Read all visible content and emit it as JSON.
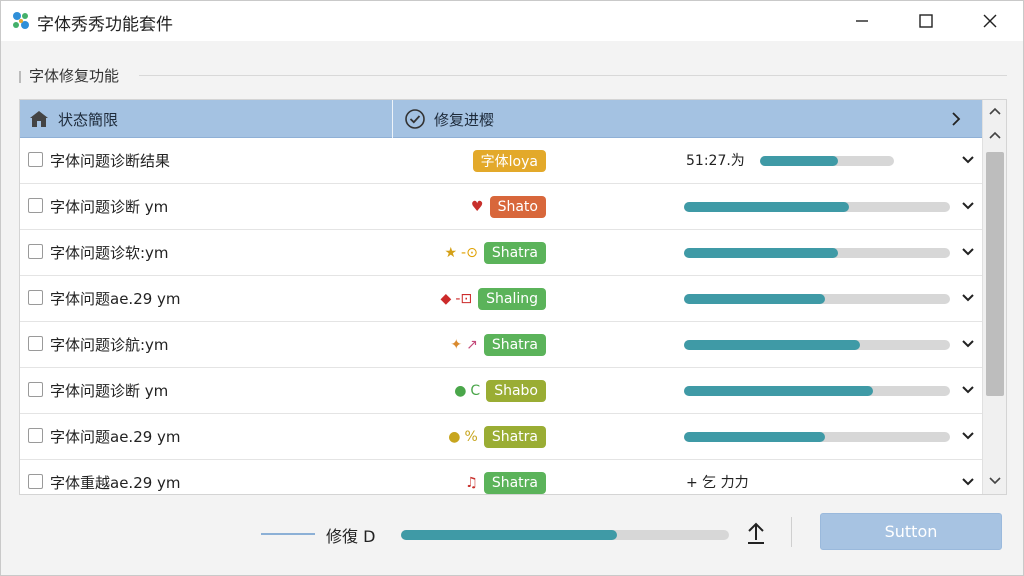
{
  "window": {
    "title": "字体秀秀功能套件",
    "controls": {
      "minimize": "minimize-icon",
      "maximize": "maximize-icon",
      "close": "close-icon"
    }
  },
  "section": {
    "title": "字体修复功能"
  },
  "table": {
    "headers": {
      "status": "状态簡限",
      "repair": "修复进樱"
    },
    "rows": [
      {
        "label": "字体问题诊断结果",
        "badge": "字体loya",
        "badge_color": "#e3a92a",
        "icons": [],
        "progress_text": "51:27.为",
        "progress": 0.58
      },
      {
        "label": "字体问题诊断 ym",
        "badge": "Shato",
        "badge_color": "#d8673b",
        "icons": [
          "♥"
        ],
        "icon_colors": [
          "#c8302c"
        ],
        "progress_text": "",
        "progress": 0.62
      },
      {
        "label": "字体问题诊软:ym",
        "badge": "Shatra",
        "badge_color": "#5bb35a",
        "icons": [
          "★",
          "-⊙"
        ],
        "icon_colors": [
          "#d4a017",
          "#e0a000"
        ],
        "progress_text": "",
        "progress": 0.58
      },
      {
        "label": "字体问题ae.29 ym",
        "badge": "Shaling",
        "badge_color": "#5bb35a",
        "icons": [
          "◆",
          "-⊡"
        ],
        "icon_colors": [
          "#cc2a2a",
          "#cc2a2a"
        ],
        "progress_text": "",
        "progress": 0.53
      },
      {
        "label": "字体问题诊航:ym",
        "badge": "Shatra",
        "badge_color": "#5bb35a",
        "icons": [
          "✦",
          "↗"
        ],
        "icon_colors": [
          "#d98a2e",
          "#c44a7a"
        ],
        "progress_text": "",
        "progress": 0.66
      },
      {
        "label": "字体问题诊断 ym",
        "badge": "Shabo",
        "badge_color": "#9aad34",
        "icons": [
          "●",
          "C"
        ],
        "icon_colors": [
          "#4aa64a",
          "#4aa64a"
        ],
        "progress_text": "",
        "progress": 0.71
      },
      {
        "label": "字体问题ae.29 ym",
        "badge": "Shatra",
        "badge_color": "#9aad34",
        "icons": [
          "●",
          "%"
        ],
        "icon_colors": [
          "#c7a51e",
          "#c7a51e"
        ],
        "progress_text": "",
        "progress": 0.53
      },
      {
        "label": "字体重越ae.29 ym",
        "badge": "Shatra",
        "badge_color": "#5bb35a",
        "icons": [
          "♫"
        ],
        "icon_colors": [
          "#c8302c"
        ],
        "progress_text": "+ 乞 力力",
        "progress": null
      }
    ]
  },
  "footer": {
    "label": "修復 D",
    "progress": 0.66,
    "button_label": "Sutton"
  },
  "colors": {
    "header_bg": "#a4c2e2",
    "bar_fill": "#3f9aa6",
    "bar_track": "#d7d7d7",
    "button_bg": "#a7c3e2"
  }
}
